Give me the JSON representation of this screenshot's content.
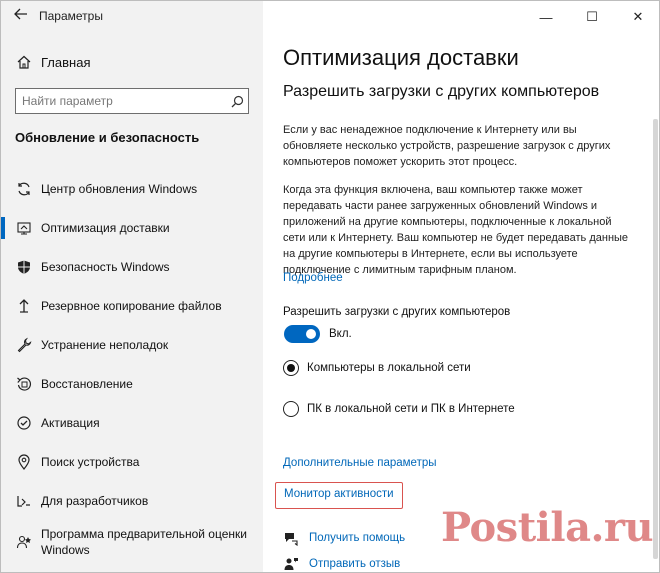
{
  "window": {
    "title": "Параметры",
    "controls": {
      "minimize": "—",
      "maximize": "☐",
      "close": "✕"
    }
  },
  "sidebar": {
    "home_label": "Главная",
    "search_placeholder": "Найти параметр",
    "section_title": "Обновление и безопасность",
    "items": [
      {
        "label": "Центр обновления Windows",
        "icon": "sync-icon",
        "active": false
      },
      {
        "label": "Оптимизация доставки",
        "icon": "delivery-optimization-icon",
        "active": true
      },
      {
        "label": "Безопасность Windows",
        "icon": "shield-icon",
        "active": false
      },
      {
        "label": "Резервное копирование файлов",
        "icon": "backup-icon",
        "active": false
      },
      {
        "label": "Устранение неполадок",
        "icon": "wrench-icon",
        "active": false
      },
      {
        "label": "Восстановление",
        "icon": "recovery-icon",
        "active": false
      },
      {
        "label": "Активация",
        "icon": "activation-icon",
        "active": false
      },
      {
        "label": "Поиск устройства",
        "icon": "find-device-icon",
        "active": false
      },
      {
        "label": "Для разработчиков",
        "icon": "developer-icon",
        "active": false
      },
      {
        "label": "Программа предварительной оценки Windows",
        "icon": "insider-icon",
        "active": false
      }
    ]
  },
  "main": {
    "page_title": "Оптимизация доставки",
    "sub_title": "Разрешить загрузки с других компьютеров",
    "paragraph1": "Если у вас ненадежное подключение к Интернету или вы обновляете несколько устройств, разрешение загрузок с других компьютеров поможет ускорить этот процесс.",
    "paragraph2": "Когда эта функция включена, ваш компьютер также может передавать части ранее загруженных обновлений Windows и приложений на другие компьютеры, подключенные к локальной сети или к Интернету. Ваш компьютер не будет передавать данные на другие компьютеры в Интернете, если вы используете подключение с лимитным тарифным планом.",
    "more_link": "Подробнее",
    "toggle_label": "Разрешить загрузки с других компьютеров",
    "toggle_state": "Вкл.",
    "toggle_on": true,
    "radio_options": [
      {
        "label": "Компьютеры в локальной сети",
        "selected": true
      },
      {
        "label": "ПК в локальной сети и ПК в Интернете",
        "selected": false
      }
    ],
    "advanced_link": "Дополнительные параметры",
    "monitor_link": "Монитор активности",
    "help_link": "Получить помощь",
    "feedback_link": "Отправить отзыв"
  },
  "watermark": {
    "text": "Postila.ru"
  },
  "colors": {
    "accent": "#0067c0",
    "link": "#0067b8",
    "highlight_border": "#d9534f",
    "sidebar_bg": "#f2f2f2"
  }
}
